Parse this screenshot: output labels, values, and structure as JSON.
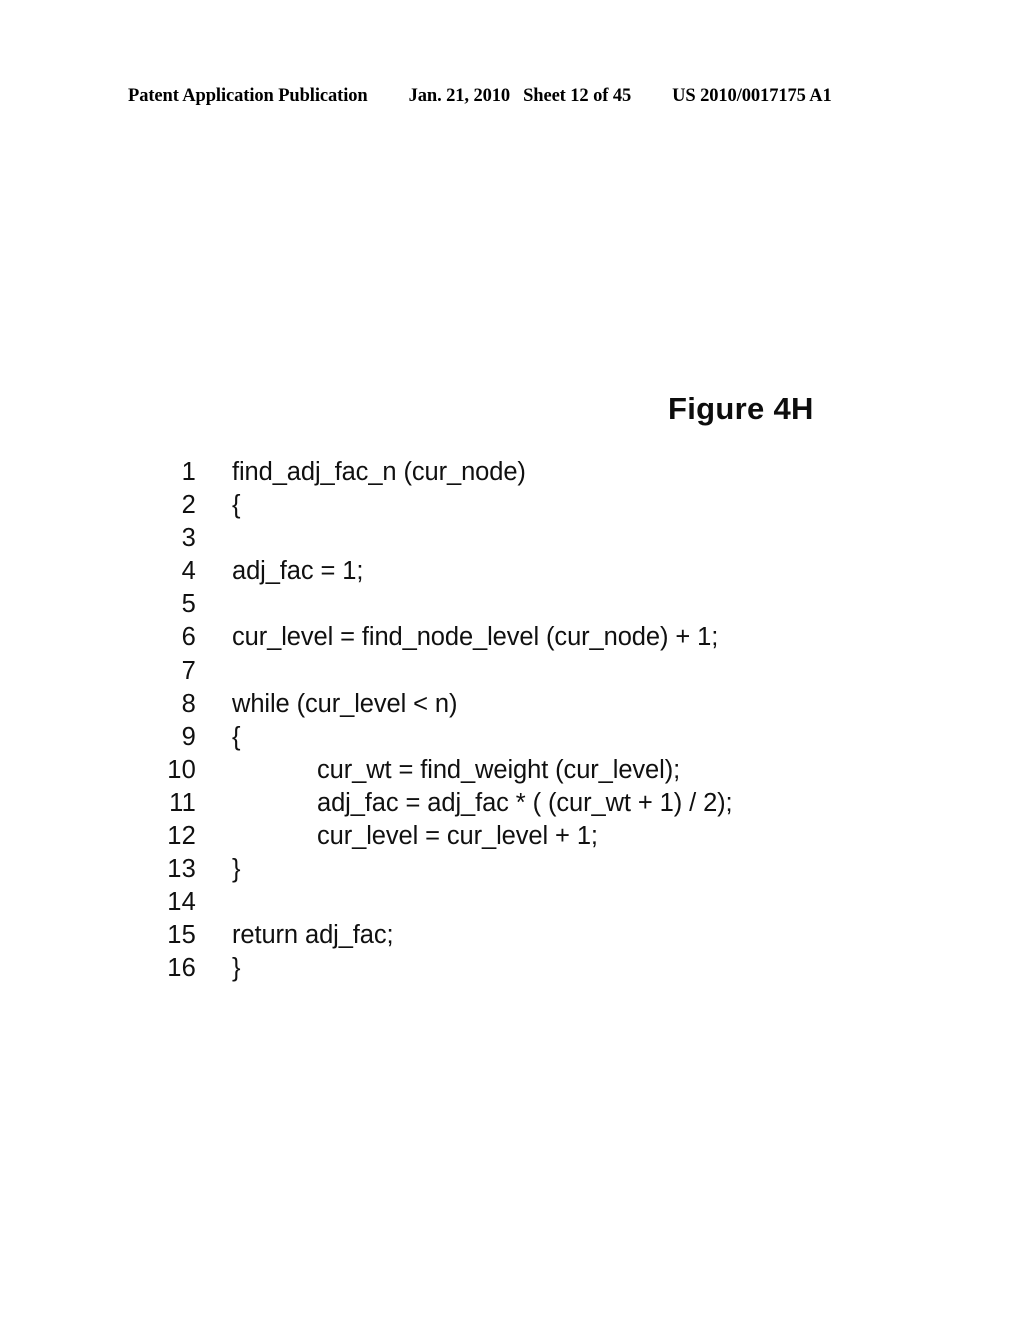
{
  "header": {
    "publication": "Patent Application Publication",
    "date": "Jan. 21, 2010",
    "sheet": "Sheet 12 of 45",
    "document_number": "US 2010/0017175 A1"
  },
  "figure": {
    "caption": "Figure 4H"
  },
  "code": {
    "lines": [
      {
        "number": "1",
        "text": "find_adj_fac_n (cur_node)",
        "indent": 0
      },
      {
        "number": "2",
        "text": "{",
        "indent": 0
      },
      {
        "number": "3",
        "text": "",
        "indent": 0
      },
      {
        "number": "4",
        "text": "adj_fac = 1;",
        "indent": 0
      },
      {
        "number": "5",
        "text": "",
        "indent": 0
      },
      {
        "number": "6",
        "text": "cur_level = find_node_level (cur_node) + 1;",
        "indent": 0
      },
      {
        "number": "7",
        "text": "",
        "indent": 0
      },
      {
        "number": "8",
        "text": "while (cur_level < n)",
        "indent": 0
      },
      {
        "number": "9",
        "text": "{",
        "indent": 0
      },
      {
        "number": "10",
        "text": "cur_wt = find_weight (cur_level);",
        "indent": 1
      },
      {
        "number": "11",
        "text": "adj_fac = adj_fac * ( (cur_wt + 1) / 2);",
        "indent": 1
      },
      {
        "number": "12",
        "text": "cur_level = cur_level + 1;",
        "indent": 1
      },
      {
        "number": "13",
        "text": "}",
        "indent": 0
      },
      {
        "number": "14",
        "text": "",
        "indent": 0
      },
      {
        "number": "15",
        "text": "return adj_fac;",
        "indent": 0
      },
      {
        "number": "16",
        "text": "}",
        "indent": 0
      }
    ]
  }
}
